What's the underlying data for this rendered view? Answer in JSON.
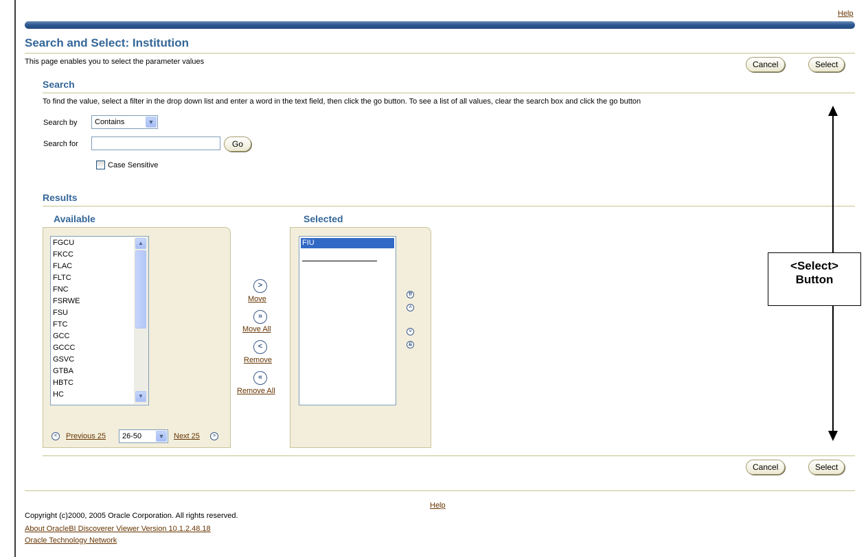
{
  "header": {
    "help": "Help",
    "title": "Search and Select: Institution",
    "subtitle": "This page enables you to select the parameter values",
    "cancel": "Cancel",
    "select": "Select"
  },
  "search": {
    "heading": "Search",
    "instructions": "To find the value, select a filter in the drop down list and enter a word in the text field, then click the go button. To see a list of all values, clear the search box and click the go button",
    "search_by_label": "Search by",
    "search_by_value": "Contains",
    "search_for_label": "Search for",
    "search_for_value": "",
    "go": "Go",
    "case_sensitive_label": "Case Sensitive",
    "case_sensitive_checked": false
  },
  "results": {
    "heading": "Results",
    "available_heading": "Available",
    "selected_heading": "Selected",
    "available_items": [
      "FGCU",
      "FKCC",
      "FLAC",
      "FLTC",
      "FNC",
      "FSRWE",
      "FSU",
      "FTC",
      "GCC",
      "GCCC",
      "GSVC",
      "GTBA",
      "HBTC",
      "HC"
    ],
    "selected_items": [
      "FIU"
    ],
    "move": "Move",
    "move_all": "Move All",
    "remove": "Remove",
    "remove_all": "Remove All",
    "previous": "Previous 25",
    "range": "26-50",
    "next": "Next 25"
  },
  "annotation": {
    "line1": "<Select>",
    "line2": "Button"
  },
  "footer": {
    "help": "Help",
    "copyright": "Copyright (c)2000, 2005 Oracle Corporation. All rights reserved.",
    "about": "About OracleBI Discoverer Viewer Version 10.1.2.48.18",
    "otn": "Oracle Technology Network"
  }
}
